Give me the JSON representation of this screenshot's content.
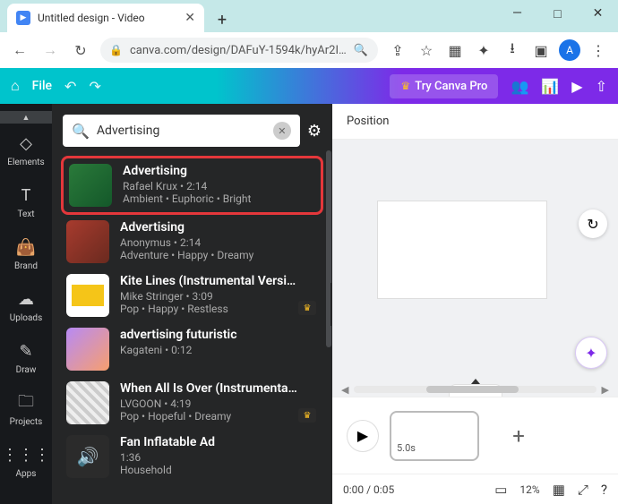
{
  "window": {
    "min": "—",
    "max": "□",
    "close": "✕"
  },
  "tab": {
    "title": "Untitled design - Video",
    "close": "✕",
    "new": "+"
  },
  "nav": {
    "back": "←",
    "forward": "→",
    "reload": "↻"
  },
  "url": {
    "lock": "🔒",
    "text": "canva.com/design/DAFuY-1594k/hyAr2I…",
    "avatar": "A"
  },
  "canva": {
    "file": "File",
    "try_pro": "Try Canva Pro"
  },
  "rail": [
    {
      "icon": "◇",
      "label": "Elements"
    },
    {
      "icon": "T",
      "label": "Text"
    },
    {
      "icon": "👜",
      "label": "Brand"
    },
    {
      "icon": "☁",
      "label": "Uploads"
    },
    {
      "icon": "✎",
      "label": "Draw"
    },
    {
      "icon": "🗀",
      "label": "Projects"
    },
    {
      "icon": "⋮⋮⋮",
      "label": "Apps"
    }
  ],
  "search": {
    "value": "Advertising",
    "clear": "✕"
  },
  "tracks": [
    {
      "title": "Advertising",
      "artist": "Rafael Krux",
      "dur": "2:14",
      "tags": "Ambient • Euphoric • Bright",
      "pro": false
    },
    {
      "title": "Advertising",
      "artist": "Anonymus",
      "dur": "2:14",
      "tags": "Adventure • Happy • Dreamy",
      "pro": false
    },
    {
      "title": "Kite Lines (Instrumental Versi…",
      "artist": "Mike Stringer",
      "dur": "3:09",
      "tags": "Pop • Happy • Restless",
      "pro": true
    },
    {
      "title": "advertising futuristic",
      "artist": "Kagateni",
      "dur": "0:12",
      "tags": "",
      "pro": false
    },
    {
      "title": "When All Is Over (Instrumenta…",
      "artist": "LVGOON",
      "dur": "4:19",
      "tags": "Pop • Hopeful • Dreamy",
      "pro": true
    },
    {
      "title": "Fan Inflatable Ad",
      "artist": "",
      "dur": "1:36",
      "tags": "Household",
      "pro": false
    }
  ],
  "canvas": {
    "position": "Position"
  },
  "timeline": {
    "clip_dur": "5.0s",
    "time": "0:00 / 0:05",
    "zoom": "12%"
  }
}
